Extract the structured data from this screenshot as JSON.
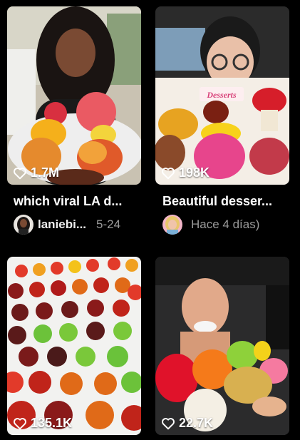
{
  "videos": [
    {
      "likes": "1.7M",
      "title": "which viral LA d...",
      "author": "laniebi...",
      "date": "5-24",
      "thumbnail": "woman-holding-fruit-shaped-desserts",
      "avatar": "woman-avatar"
    },
    {
      "likes": "198K",
      "title": "Beautiful desser...",
      "author": "",
      "date": "Hace 4 días)",
      "thumbnail": "woman-in-car-with-dessert-box",
      "thumbnail_label": "Desserts",
      "avatar": "blonde-woman-avatar"
    },
    {
      "likes": "135.1K",
      "thumbnail": "rows-of-fruit-shaped-pastries"
    },
    {
      "likes": "22.7K",
      "thumbnail": "woman-in-car-with-fruit-desserts"
    }
  ],
  "colors": {
    "background": "#000000",
    "date_text": "#9a9a9a"
  },
  "icons": {
    "like": "heart-outline-icon"
  }
}
